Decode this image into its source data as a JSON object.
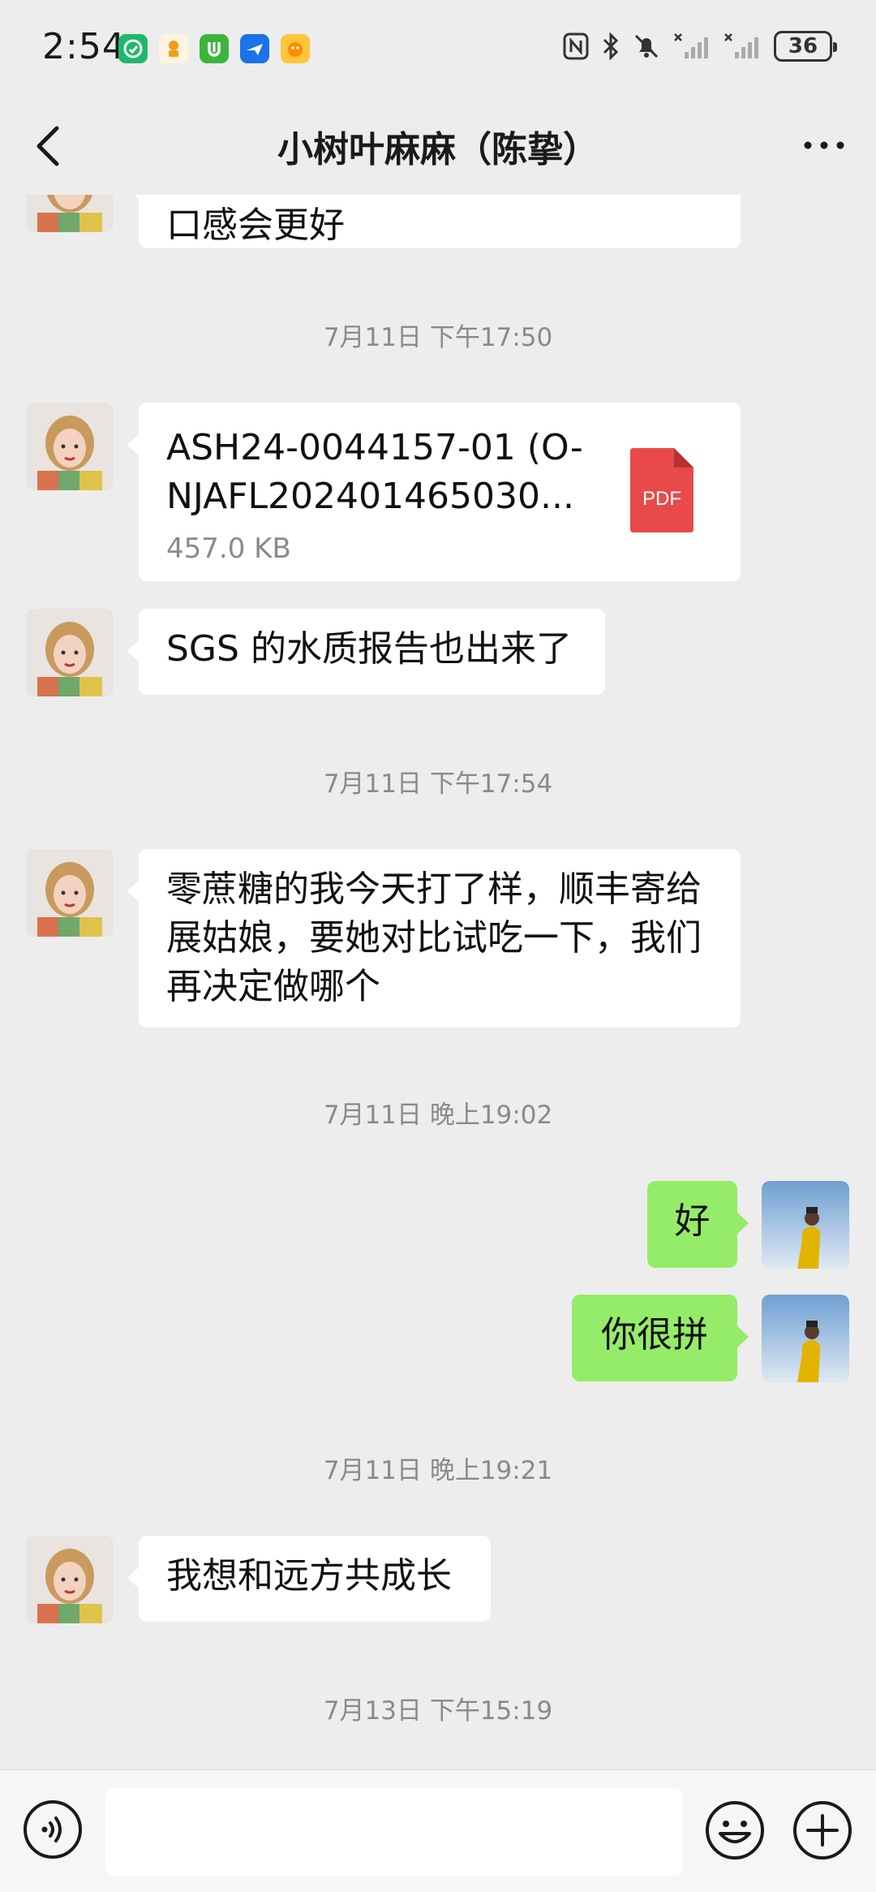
{
  "status_bar": {
    "time": "2:54",
    "battery": "36"
  },
  "header": {
    "title": "小树叶麻麻（陈挚）"
  },
  "messages": {
    "partial_text": "口感会更好",
    "ts1": "7月11日 下午17:50",
    "file": {
      "name": "ASH24-0044157-01 (O-\nNJAFL202401465030...",
      "size": "457.0 KB",
      "type_label": "PDF"
    },
    "sgs_text": "SGS 的水质报告也出来了",
    "ts2": "7月11日 下午17:54",
    "sugar_text": "零蔗糖的我今天打了样，顺丰寄给展姑娘，要她对比试吃一下，我们再决定做哪个",
    "ts3": "7月11日 晚上19:02",
    "reply_ok": "好",
    "reply_hard": "你很拼",
    "ts4": "7月11日 晚上19:21",
    "grow_text": "我想和远方共成长",
    "ts5": "7月13日 下午15:19"
  },
  "input": {
    "placeholder": ""
  }
}
